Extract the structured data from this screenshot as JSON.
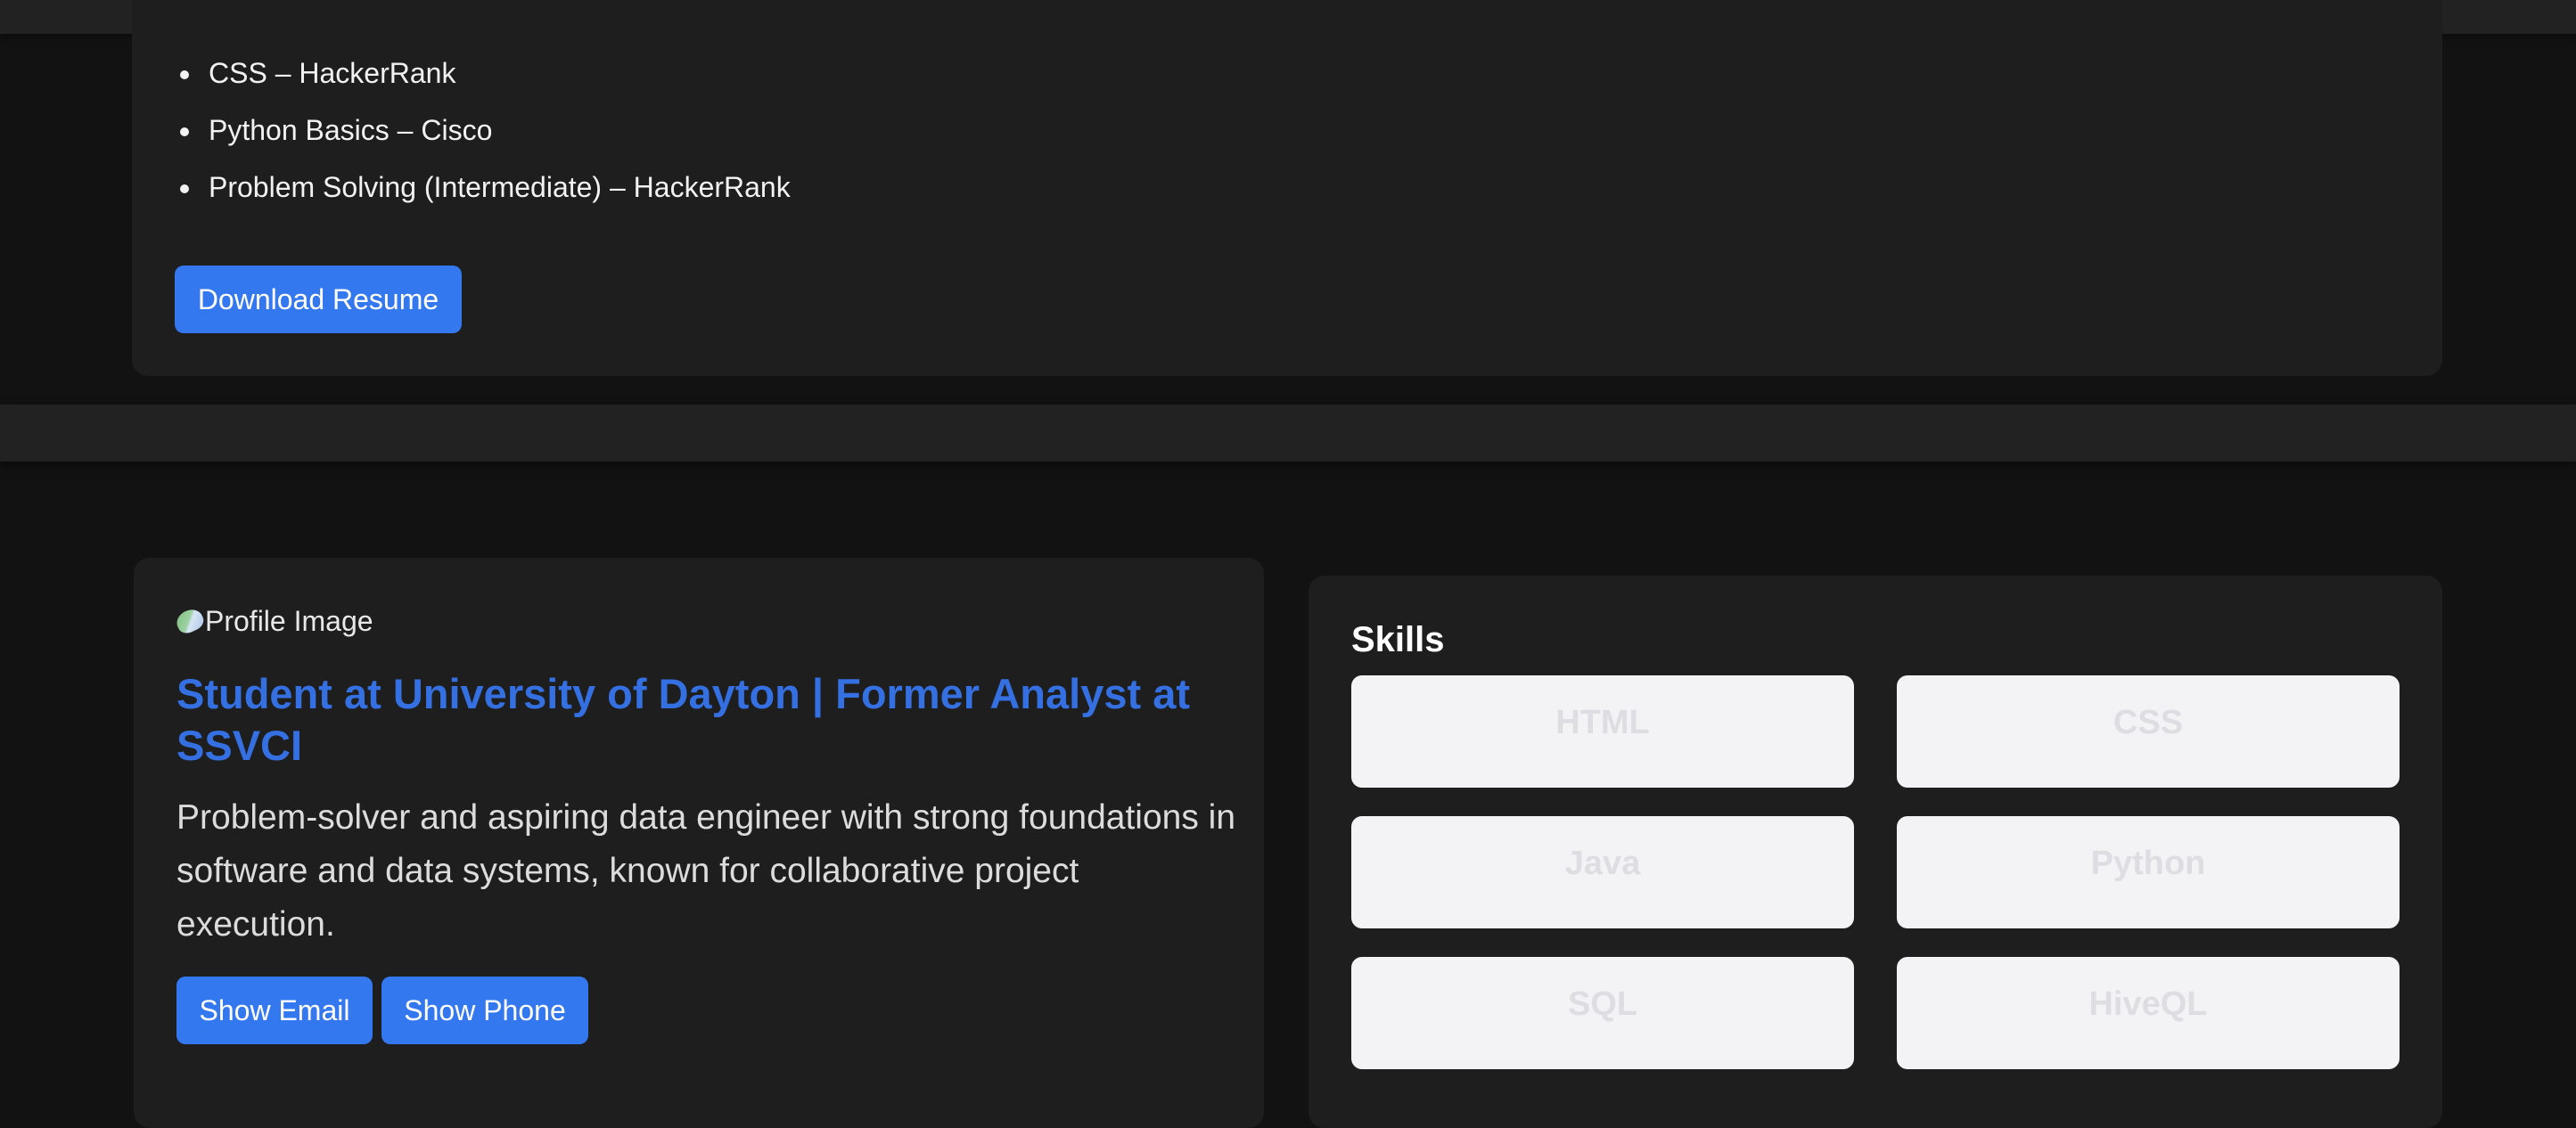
{
  "certifications": {
    "items": [
      "CSS – HackerRank",
      "Python Basics – Cisco",
      "Problem Solving (Intermediate) – HackerRank"
    ],
    "download_label": "Download Resume"
  },
  "profile": {
    "image_alt": "Profile Image",
    "headline": "Student at University of Dayton | Former Analyst at SSVCI",
    "summary": "Problem-solver and aspiring data engineer with strong foundations in software and data systems, known for collaborative project execution.",
    "email_label": "Show Email",
    "phone_label": "Show Phone"
  },
  "skills": {
    "title": "Skills",
    "items": [
      "HTML",
      "CSS",
      "Java",
      "Python",
      "SQL",
      "HiveQL"
    ]
  },
  "colors": {
    "accent": "#3478f0",
    "headline": "#3470e2",
    "background": "#121212",
    "card": "#1e1e1e"
  }
}
